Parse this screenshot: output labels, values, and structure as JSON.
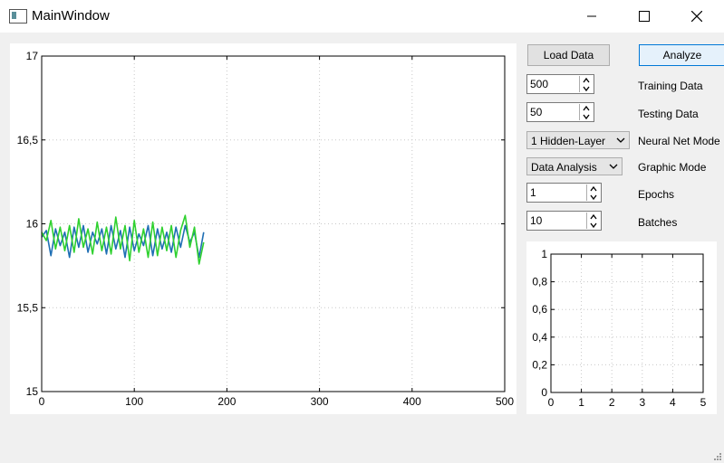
{
  "window": {
    "title": "MainWindow",
    "icons": [
      "app-icon",
      "minimize-icon",
      "maximize-icon",
      "close-icon"
    ]
  },
  "buttons": {
    "load_data": "Load Data",
    "analyze": "Analyze"
  },
  "fields": {
    "training_data": {
      "value": "500",
      "label": "Training Data"
    },
    "testing_data": {
      "value": "50",
      "label": "Testing Data"
    },
    "neural_net_mode": {
      "value": "1 Hidden-Layer",
      "label": "Neural Net Mode"
    },
    "graphic_mode": {
      "value": "Data Analysis",
      "label": "Graphic Mode"
    },
    "epochs": {
      "value": "1",
      "label": "Epochs"
    },
    "batches": {
      "value": "10",
      "label": "Batches"
    }
  },
  "colors": {
    "series_primary": "#1f6fb4",
    "series_secondary": "#2fd12f",
    "active_button": "#0078d7",
    "grid": "#c8c8c8"
  },
  "chart_data": [
    {
      "type": "line",
      "title": "",
      "xlabel": "",
      "ylabel": "",
      "xlim": [
        0,
        500
      ],
      "ylim": [
        15,
        17
      ],
      "x_ticks": [
        "0",
        "100",
        "200",
        "300",
        "400",
        "500"
      ],
      "y_ticks": [
        "15",
        "15,5",
        "16",
        "16,5",
        "17"
      ],
      "grid": true,
      "series": [
        {
          "color": "#1f6fb4",
          "x": [
            0,
            5,
            10,
            15,
            20,
            25,
            30,
            35,
            40,
            45,
            50,
            55,
            60,
            65,
            70,
            75,
            80,
            85,
            90,
            95,
            100,
            105,
            110,
            115,
            120,
            125,
            130,
            135,
            140,
            145,
            150,
            155,
            160,
            165,
            170,
            175
          ],
          "y": [
            15.92,
            15.96,
            15.81,
            15.97,
            15.87,
            15.95,
            15.8,
            15.98,
            15.86,
            15.99,
            15.83,
            15.95,
            15.88,
            15.97,
            15.82,
            15.99,
            15.85,
            15.96,
            15.8,
            15.98,
            15.84,
            15.94,
            15.87,
            15.99,
            15.81,
            15.97,
            15.85,
            15.95,
            15.83,
            15.98,
            15.86,
            15.99,
            15.89,
            15.95,
            15.8,
            15.95
          ]
        },
        {
          "color": "#2fd12f",
          "x": [
            0,
            5,
            10,
            15,
            20,
            25,
            30,
            35,
            40,
            45,
            50,
            55,
            60,
            65,
            70,
            75,
            80,
            85,
            90,
            95,
            100,
            105,
            110,
            115,
            120,
            125,
            130,
            135,
            140,
            145,
            150,
            155,
            160,
            165,
            170,
            175
          ],
          "y": [
            15.95,
            15.9,
            16.02,
            15.85,
            15.98,
            15.84,
            15.99,
            15.83,
            16.03,
            15.86,
            15.97,
            15.82,
            16.01,
            15.84,
            15.98,
            15.82,
            16.04,
            15.85,
            15.99,
            15.78,
            16.02,
            15.83,
            15.97,
            15.8,
            16.01,
            15.81,
            15.98,
            15.84,
            15.99,
            15.8,
            15.96,
            16.05,
            15.86,
            15.98,
            15.76,
            15.89
          ]
        }
      ]
    },
    {
      "type": "line",
      "title": "",
      "xlabel": "",
      "ylabel": "",
      "xlim": [
        0,
        5
      ],
      "ylim": [
        0,
        1
      ],
      "x_ticks": [
        "0",
        "1",
        "2",
        "3",
        "4",
        "5"
      ],
      "y_ticks": [
        "0",
        "0,2",
        "0,4",
        "0,6",
        "0,8",
        "1"
      ],
      "grid": true,
      "series": []
    }
  ]
}
